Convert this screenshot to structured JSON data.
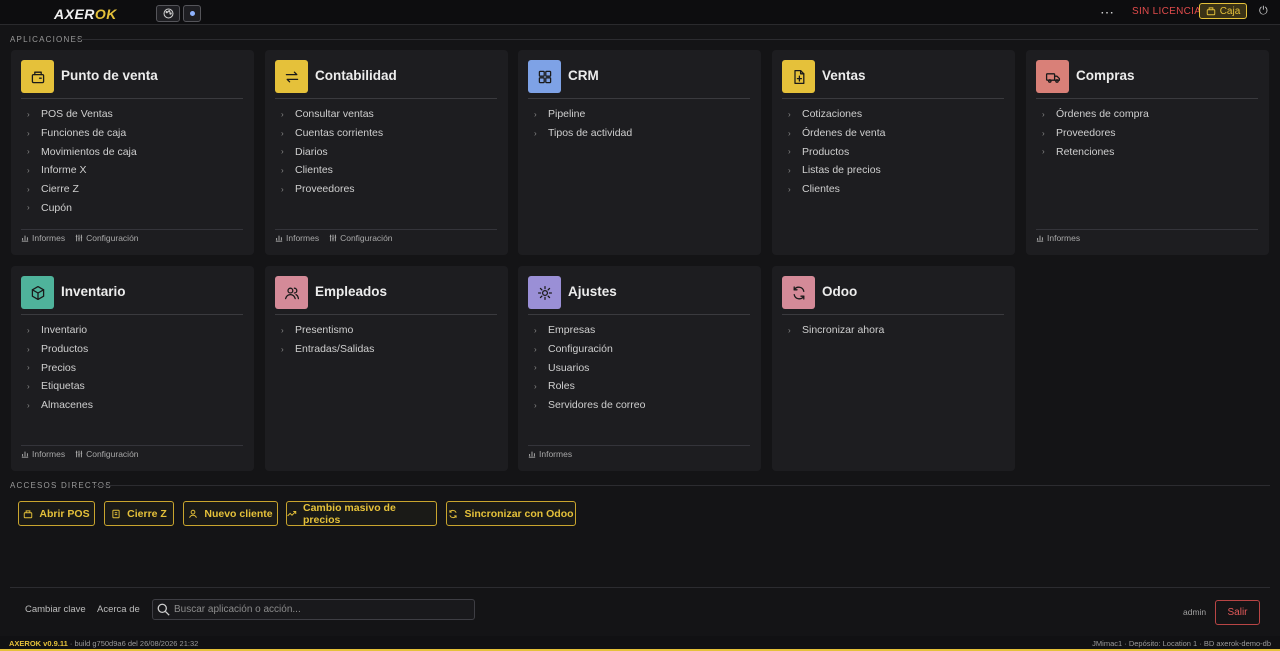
{
  "topbar": {
    "logo_left": "AXER",
    "logo_right": "OK",
    "license": "SIN LICENCIA",
    "caja_label": "Caja"
  },
  "sections": {
    "apps": "APLICACIONES",
    "shortcuts": "ACCESOS DIRECTOS"
  },
  "footer_links": {
    "reports": "Informes",
    "config": "Configuración"
  },
  "apps": [
    {
      "title": "Punto de venta",
      "color": "#e5c13a",
      "icon": "cash-register-icon",
      "items": [
        "POS de Ventas",
        "Funciones de caja",
        "Movimientos de caja",
        "Informe X",
        "Cierre Z",
        "Cupón"
      ],
      "foot": [
        "Informes",
        "Configuración"
      ]
    },
    {
      "title": "Contabilidad",
      "color": "#e5c13a",
      "icon": "swap-arrows-icon",
      "items": [
        "Consultar ventas",
        "Cuentas corrientes",
        "Diarios",
        "Clientes",
        "Proveedores"
      ],
      "foot": [
        "Informes",
        "Configuración"
      ]
    },
    {
      "title": "CRM",
      "color": "#7ea2e6",
      "icon": "grid-icon",
      "items": [
        "Pipeline",
        "Tipos de actividad"
      ],
      "foot": []
    },
    {
      "title": "Ventas",
      "color": "#e5c13a",
      "icon": "invoice-icon",
      "items": [
        "Cotizaciones",
        "Órdenes de venta",
        "Productos",
        "Listas de precios",
        "Clientes"
      ],
      "foot": []
    },
    {
      "title": "Compras",
      "color": "#d98078",
      "icon": "truck-icon",
      "items": [
        "Órdenes de compra",
        "Proveedores",
        "Retenciones"
      ],
      "foot": [
        "Informes"
      ]
    },
    {
      "title": "Inventario",
      "color": "#4fb39b",
      "icon": "box-icon",
      "items": [
        "Inventario",
        "Productos",
        "Precios",
        "Etiquetas",
        "Almacenes"
      ],
      "foot": [
        "Informes",
        "Configuración"
      ]
    },
    {
      "title": "Empleados",
      "color": "#d48a98",
      "icon": "users-icon",
      "items": [
        "Presentismo",
        "Entradas/Salidas"
      ],
      "foot": []
    },
    {
      "title": "Ajustes",
      "color": "#9a8fd6",
      "icon": "gear-icon",
      "items": [
        "Empresas",
        "Configuración",
        "Usuarios",
        "Roles",
        "Servidores de correo"
      ],
      "foot": [
        "Informes"
      ]
    },
    {
      "title": "Odoo",
      "color": "#d48a98",
      "icon": "sync-icon",
      "items": [
        "Sincronizar ahora"
      ],
      "foot": []
    }
  ],
  "shortcuts": [
    "Abrir POS",
    "Cierre Z",
    "Nuevo cliente",
    "Cambio masivo de precios",
    "Sincronizar con Odoo"
  ],
  "bottom": {
    "change_password": "Cambiar clave",
    "about": "Acerca de",
    "search_placeholder": "Buscar aplicación o acción...",
    "user": "admin",
    "logout": "Salir"
  },
  "status": {
    "version": "AXEROK v0.9.11",
    "build": " · build g750d9a6 del 26/08/2026 21:32",
    "right": "JMimac1 · Depósito: Location 1 · BD axerok-demo-db"
  }
}
